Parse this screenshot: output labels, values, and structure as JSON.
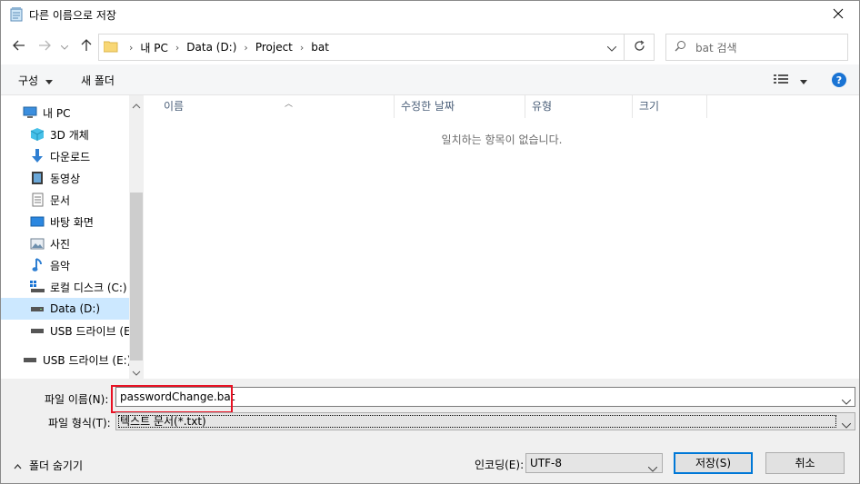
{
  "window": {
    "title": "다른 이름으로 저장"
  },
  "nav": {
    "breadcrumb": [
      "내 PC",
      "Data (D:)",
      "Project",
      "bat"
    ],
    "search_placeholder": "bat 검색"
  },
  "toolbar": {
    "organize_label": "구성",
    "new_folder_label": "새 폴더",
    "help_glyph": "?"
  },
  "sidebar": {
    "items": [
      {
        "label": "내 PC",
        "icon": "pc-icon"
      },
      {
        "label": "3D 개체",
        "icon": "cube-3d-icon"
      },
      {
        "label": "다운로드",
        "icon": "download-arrow-icon"
      },
      {
        "label": "동영상",
        "icon": "video-icon"
      },
      {
        "label": "문서",
        "icon": "document-icon"
      },
      {
        "label": "바탕 화면",
        "icon": "desktop-icon"
      },
      {
        "label": "사진",
        "icon": "picture-icon"
      },
      {
        "label": "음악",
        "icon": "music-icon"
      },
      {
        "label": "로컬 디스크 (C:)",
        "icon": "local-disk-icon"
      },
      {
        "label": "Data (D:)",
        "icon": "drive-icon",
        "selected": true
      },
      {
        "label": "USB 드라이브 (E:)",
        "icon": "usb-drive-icon"
      },
      {
        "label": "USB 드라이브 (E:)",
        "icon": "usb-drive-icon"
      }
    ]
  },
  "filelist": {
    "columns": [
      "이름",
      "수정한 날짜",
      "유형",
      "크기"
    ],
    "empty_message": "일치하는 항목이 없습니다."
  },
  "form": {
    "filename_label": "파일 이름(N):",
    "filename_value": "passwordChange.bat",
    "filetype_label": "파일 형식(T):",
    "filetype_value": "텍스트 문서(*.txt)",
    "hide_folders_label": "폴더 숨기기",
    "encoding_label": "인코딩(E):",
    "encoding_value": "UTF-8",
    "save_label": "저장(S)",
    "cancel_label": "취소"
  },
  "colors": {
    "accent": "#0078d7",
    "highlight_box": "#e81123",
    "selected_bg": "#cce8ff"
  }
}
